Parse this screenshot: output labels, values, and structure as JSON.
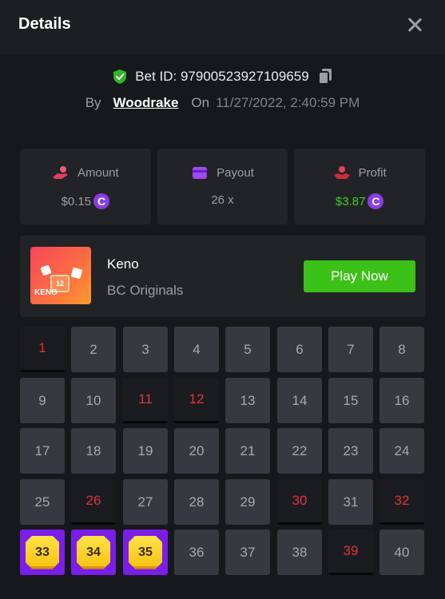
{
  "header": {
    "title": "Details",
    "close_icon": "close-icon"
  },
  "bet": {
    "id_label": "Bet ID: 97900523927109659",
    "by_label": "By",
    "username": "Woodrake",
    "on_label": "On",
    "datetime": "11/27/2022, 2:40:59 PM",
    "verified_icon": "shield-check-icon",
    "copy_icon": "copy-icon"
  },
  "stats": {
    "amount": {
      "label": "Amount",
      "value": "$0.15",
      "icon": "hand-coins-icon"
    },
    "payout": {
      "label": "Payout",
      "value": "26 x",
      "icon": "wallet-icon"
    },
    "profit": {
      "label": "Profit",
      "value": "$3.87",
      "icon": "profit-hand-icon"
    },
    "coin_symbol": "C"
  },
  "game": {
    "name": "Keno",
    "subtitle": "BC Originals",
    "play_label": "Play Now",
    "thumb_label": "KENO",
    "thumb_tile": "12"
  },
  "keno": {
    "numbers": [
      1,
      2,
      3,
      4,
      5,
      6,
      7,
      8,
      9,
      10,
      11,
      12,
      13,
      14,
      15,
      16,
      17,
      18,
      19,
      20,
      21,
      22,
      23,
      24,
      25,
      26,
      27,
      28,
      29,
      30,
      31,
      32,
      33,
      34,
      35,
      36,
      37,
      38,
      39,
      40
    ],
    "drawn": [
      1,
      11,
      12,
      26,
      30,
      32,
      39
    ],
    "matched": [
      33,
      34,
      35
    ]
  },
  "colors": {
    "accent_green": "#3bc117",
    "profit_green": "#3cd324",
    "hit_red": "#e2323f",
    "match_purple": "#7a1ee8",
    "coin_purple": "#8b3de4"
  }
}
